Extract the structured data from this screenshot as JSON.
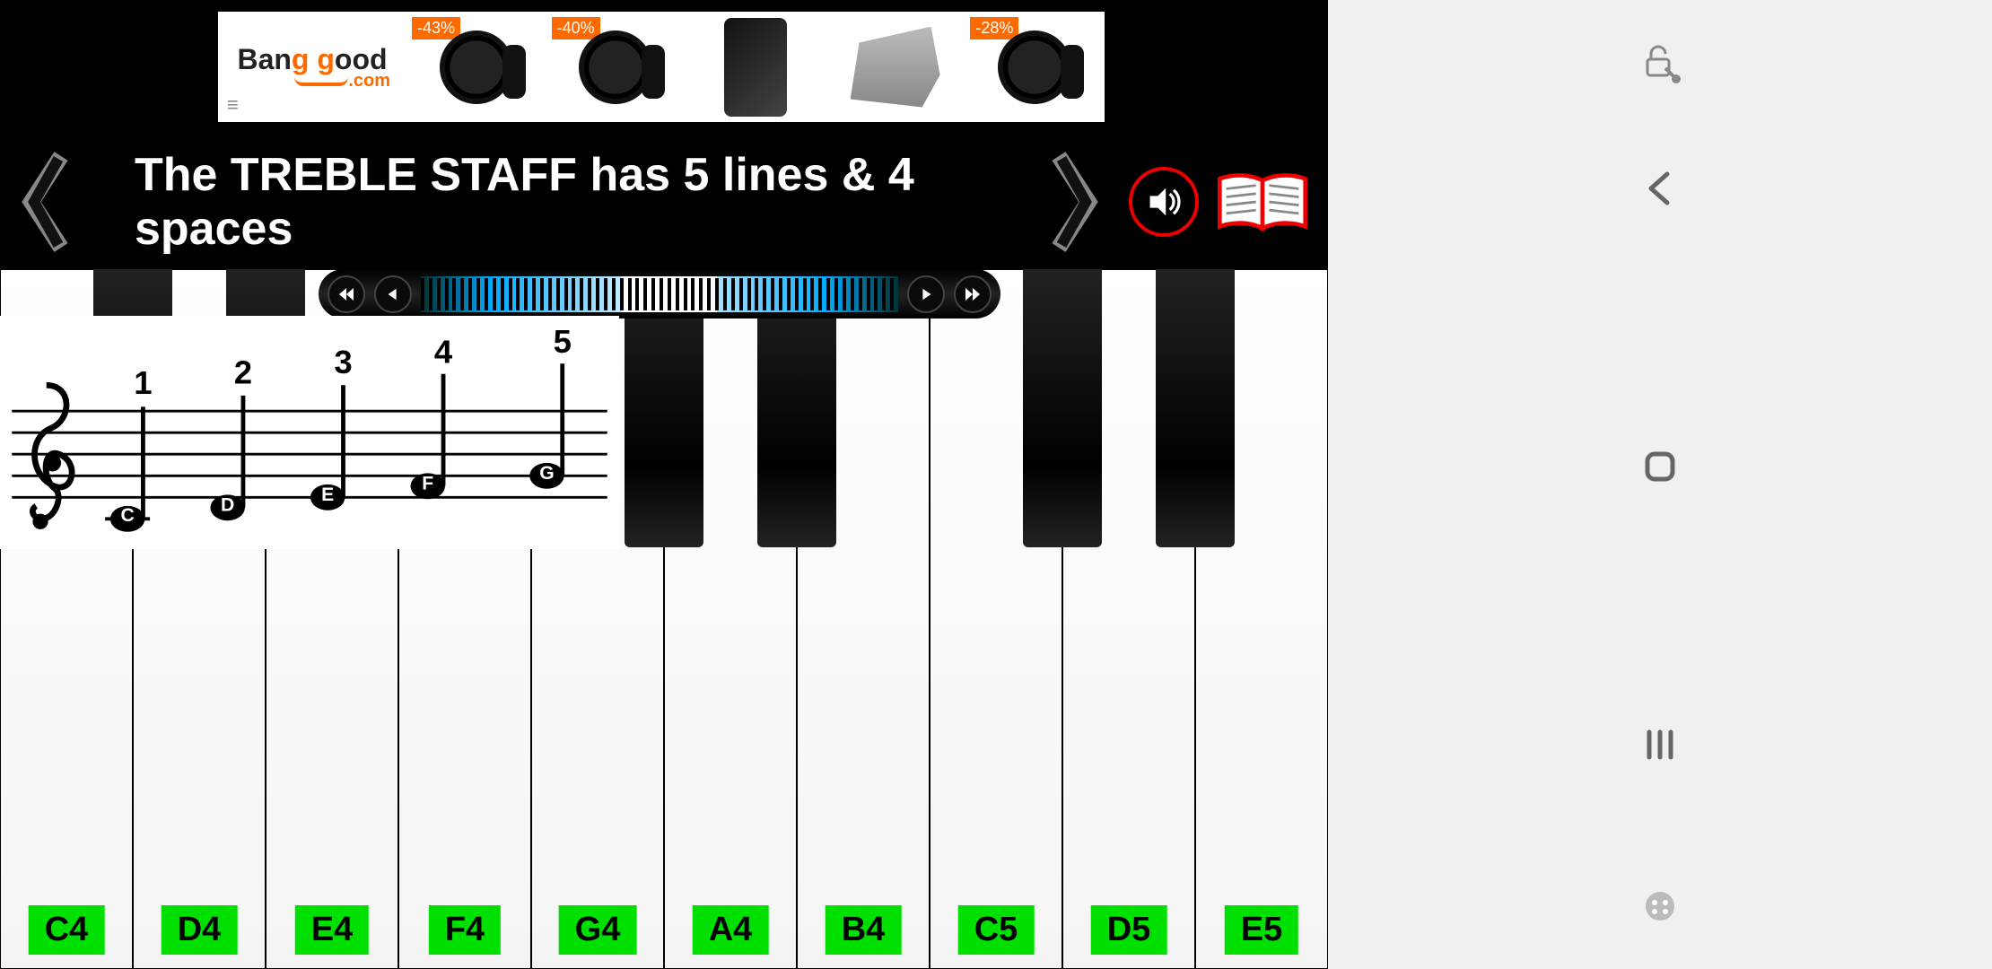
{
  "ad": {
    "brand_part1": "Ban",
    "brand_part2": "g g",
    "brand_part3": "ood",
    "brand_domain": ".com",
    "products": [
      {
        "badge": "-43%",
        "kind": "watch"
      },
      {
        "badge": "-40%",
        "kind": "watch"
      },
      {
        "badge": "",
        "kind": "phone"
      },
      {
        "badge": "",
        "kind": "engine"
      },
      {
        "badge": "-28%",
        "kind": "watch"
      }
    ]
  },
  "lesson": {
    "title": "The TREBLE STAFF has 5 lines & 4 spaces"
  },
  "staff_notes": [
    {
      "num": "1",
      "letter": "C"
    },
    {
      "num": "2",
      "letter": "D"
    },
    {
      "num": "3",
      "letter": "E"
    },
    {
      "num": "4",
      "letter": "F"
    },
    {
      "num": "5",
      "letter": "G"
    }
  ],
  "keys": {
    "white": [
      "C4",
      "D4",
      "E4",
      "F4",
      "G4",
      "A4",
      "B4",
      "C5",
      "D5",
      "E5"
    ]
  },
  "sysbar": {
    "lock": "lock-touch",
    "back": "back",
    "home": "home",
    "recent": "recent",
    "game": "game"
  }
}
